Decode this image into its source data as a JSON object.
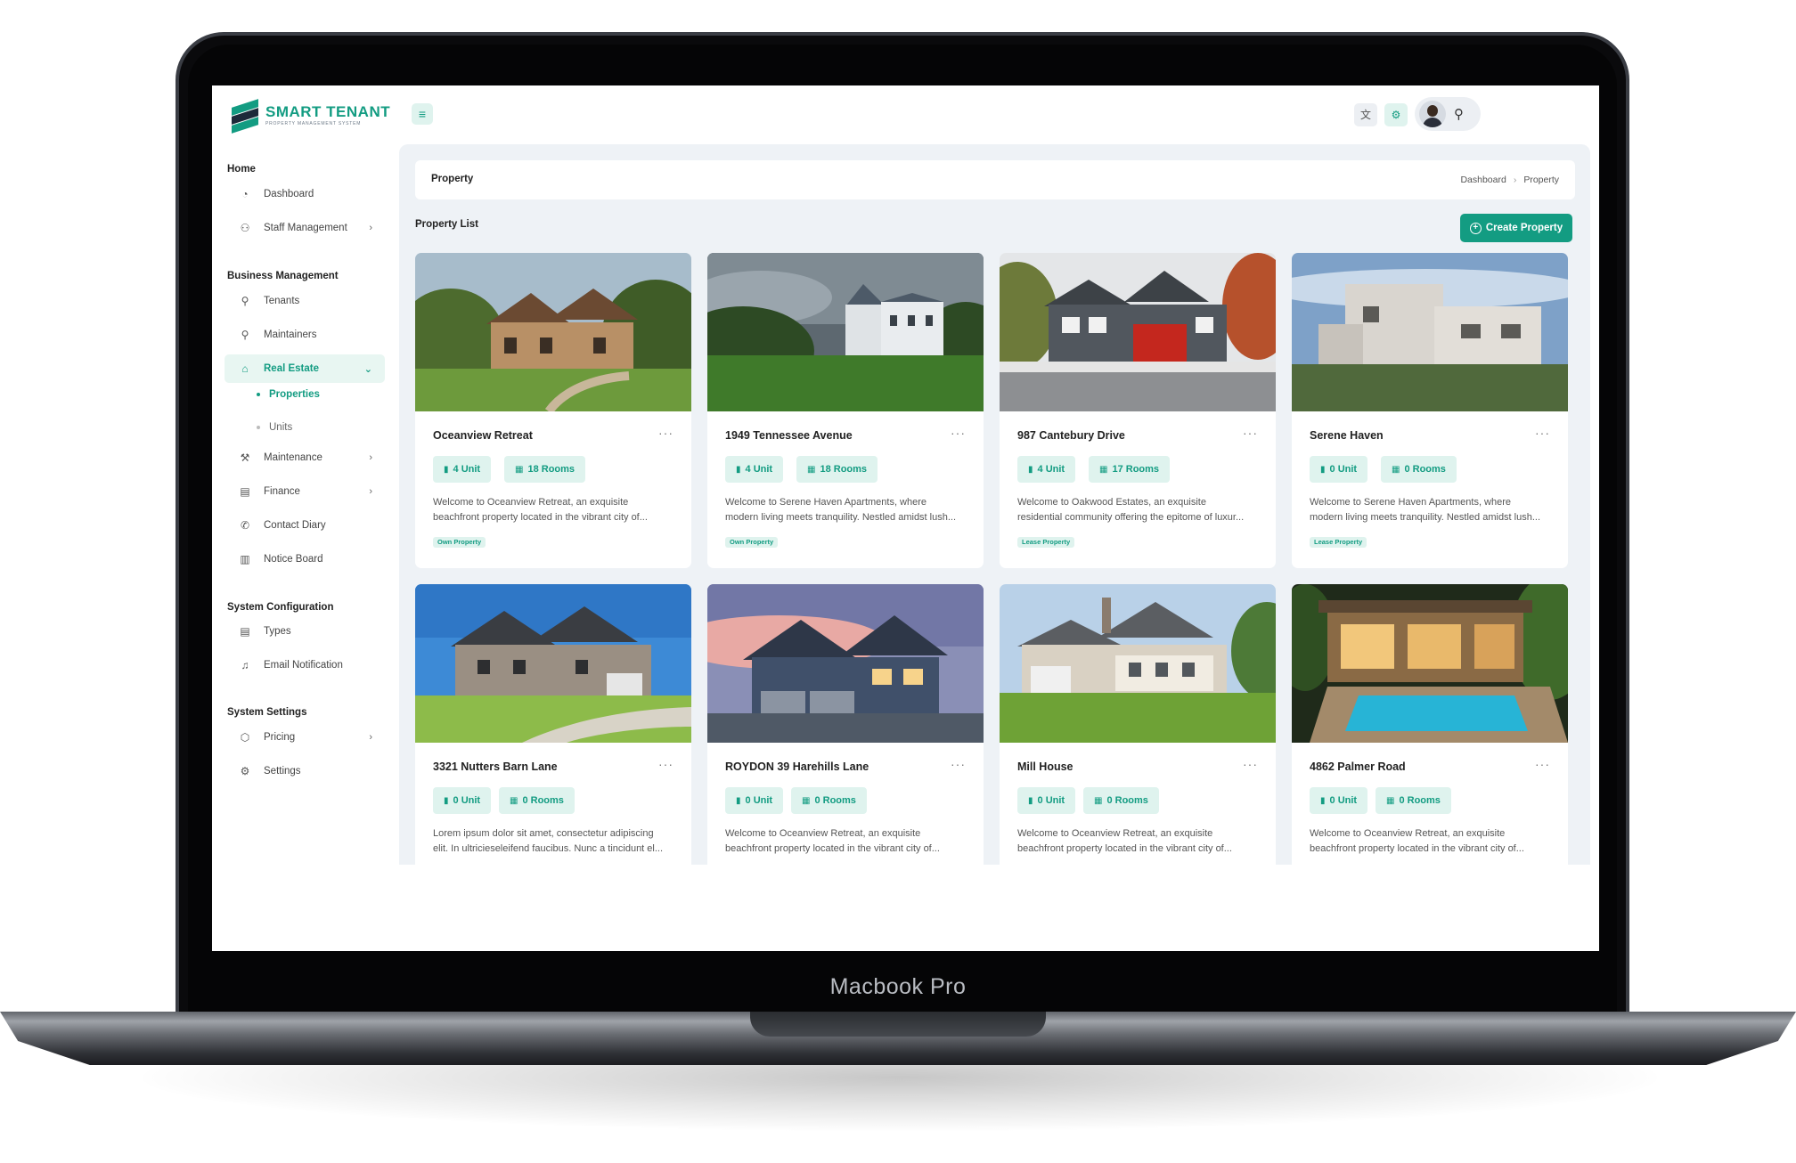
{
  "device": {
    "model_label": "Macbook Pro"
  },
  "brand": {
    "title": "SMART TENANT",
    "subtitle": "PROPERTY MANAGEMENT SYSTEM",
    "accent": "#139c82"
  },
  "sidebar": {
    "sections": [
      {
        "label": "Home"
      },
      {
        "label": "Business Management"
      },
      {
        "label": "System Configuration"
      },
      {
        "label": "System Settings"
      }
    ],
    "items": [
      {
        "label": "Dashboard",
        "icon": "dashboard-icon"
      },
      {
        "label": "Staff Management",
        "icon": "users-icon"
      },
      {
        "label": "Tenants",
        "icon": "user-icon"
      },
      {
        "label": "Maintainers",
        "icon": "user-check-icon"
      },
      {
        "label": "Real Estate",
        "icon": "home-icon"
      },
      {
        "label": "Maintenance",
        "icon": "tool-icon"
      },
      {
        "label": "Finance",
        "icon": "file-icon"
      },
      {
        "label": "Contact Diary",
        "icon": "phone-icon"
      },
      {
        "label": "Notice Board",
        "icon": "clipboard-icon"
      },
      {
        "label": "Types",
        "icon": "file-text-icon"
      },
      {
        "label": "Email Notification",
        "icon": "bell-icon"
      },
      {
        "label": "Pricing",
        "icon": "package-icon"
      },
      {
        "label": "Settings",
        "icon": "gear-icon"
      }
    ],
    "subitems": [
      {
        "label": "Properties"
      },
      {
        "label": "Units"
      }
    ]
  },
  "topbar": {
    "icons": [
      "menu-icon",
      "translate-icon",
      "settings-icon",
      "user-plus-icon"
    ]
  },
  "page": {
    "title": "Property",
    "breadcrumb": [
      "Dashboard",
      "Property"
    ],
    "list_title": "Property List",
    "create_label": "Create Property"
  },
  "properties": [
    {
      "name": "Oceanview Retreat",
      "units": "4 Unit",
      "rooms": "18 Rooms",
      "desc1": "Welcome to Oceanview Retreat, an exquisite",
      "desc2": "beachfront property located in the vibrant city of...",
      "badge": "Own Property"
    },
    {
      "name": "1949 Tennessee Avenue",
      "units": "4 Unit",
      "rooms": "18 Rooms",
      "desc1": "Welcome to Serene Haven Apartments, where",
      "desc2": "modern living meets tranquility. Nestled amidst lush...",
      "badge": "Own Property"
    },
    {
      "name": "987 Cantebury Drive",
      "units": "4 Unit",
      "rooms": "17 Rooms",
      "desc1": "Welcome to Oakwood Estates, an exquisite",
      "desc2": "residential community offering the epitome of luxur...",
      "badge": "Lease Property"
    },
    {
      "name": "Serene Haven",
      "units": "0 Unit",
      "rooms": "0 Rooms",
      "desc1": "Welcome to Serene Haven Apartments, where",
      "desc2": "modern living meets tranquility. Nestled amidst lush...",
      "badge": "Lease Property"
    },
    {
      "name": "3321 Nutters Barn Lane",
      "units": "0 Unit",
      "rooms": "0 Rooms",
      "desc1": "Lorem ipsum dolor sit amet, consectetur adipiscing",
      "desc2": "elit. In ultricieseleifend faucibus. Nunc a tincidunt el...",
      "badge": ""
    },
    {
      "name": "ROYDON 39 Harehills Lane",
      "units": "0 Unit",
      "rooms": "0 Rooms",
      "desc1": "Welcome to Oceanview Retreat, an exquisite",
      "desc2": "beachfront property located in the vibrant city of...",
      "badge": ""
    },
    {
      "name": "Mill House",
      "units": "0 Unit",
      "rooms": "0 Rooms",
      "desc1": "Welcome to Oceanview Retreat, an exquisite",
      "desc2": "beachfront property located in the vibrant city of...",
      "badge": ""
    },
    {
      "name": "4862 Palmer Road",
      "units": "0 Unit",
      "rooms": "0 Rooms",
      "desc1": "Welcome to Oceanview Retreat, an exquisite",
      "desc2": "beachfront property located in the vibrant city of...",
      "badge": ""
    }
  ]
}
